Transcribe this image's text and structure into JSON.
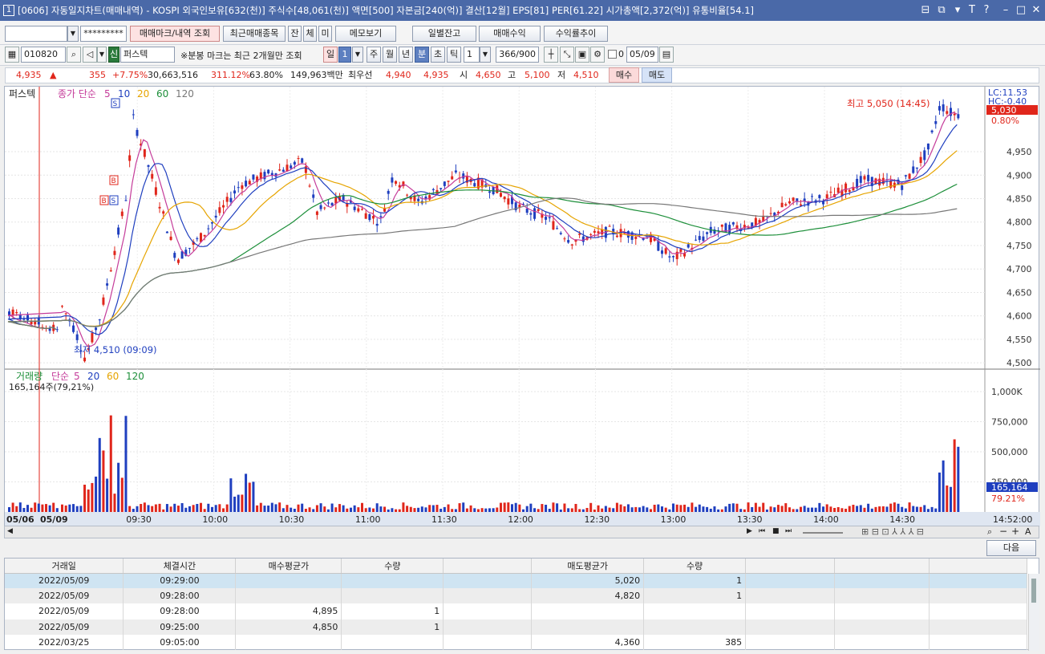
{
  "window": {
    "id": "1",
    "title": "[0606] 자동일지차트(매매내역) - KOSPI 외국인보유[632(천)] 주식수[48,061(천)] 액면[500] 자본금[240(억)] 결산[12월] EPS[81] PER[61.22] 시가총액[2,372(억)] 유통비율[54.1]"
  },
  "toolbar1": {
    "account_value": "",
    "password_mask": "*********",
    "btn_trade_mark": "매매마크/내역 조회",
    "btn_recent": "최근매매종목",
    "btn_jan": "잔",
    "btn_che": "체",
    "btn_mi": "미",
    "btn_memo": "메모보기",
    "btn_daily": "일별잔고",
    "btn_profit": "매매수익",
    "btn_trend": "수익률추이"
  },
  "toolbar2": {
    "stock_code": "010820",
    "market_badge": "신",
    "stock_name": "퍼스텍",
    "notice": "※분봉 마크는 최근 2개월만 조회",
    "period_day": "일",
    "period_num": "1",
    "period_week": "주",
    "period_month": "월",
    "period_year": "년",
    "period_min": "분",
    "period_sec": "초",
    "period_tick": "틱",
    "interval": "1",
    "count": "366/900",
    "zero_label": "0",
    "date": "05/09"
  },
  "quote": {
    "price": "4,935",
    "arrow": "▲",
    "change": "355",
    "rate": "+7.75%",
    "volume": "30,663,516",
    "vol_ratio": "311.12%",
    "turnover": "63.80%",
    "amount": "149,963백만",
    "priority_label": "최우선",
    "ask": "4,940",
    "bid": "4,935",
    "open_label": "시",
    "open": "4,650",
    "high_label": "고",
    "high": "5,100",
    "low_label": "저",
    "low": "4,510",
    "buy_btn": "매수",
    "sell_btn": "매도"
  },
  "chart_data": {
    "type": "candlestick",
    "stock": "퍼스텍",
    "indicator_title": "종가 단순",
    "ma_periods": [
      "5",
      "10",
      "20",
      "60",
      "120"
    ],
    "ma_colors": [
      "#c53c9a",
      "#1f3fbf",
      "#e6a400",
      "#1d8f3a",
      "#777777"
    ],
    "up_color": "#e0261b",
    "down_color": "#1f3fbf",
    "price_axis": [
      "4,950",
      "4,900",
      "4,850",
      "4,800",
      "4,750",
      "4,700",
      "4,650",
      "4,600",
      "4,550",
      "4,500"
    ],
    "price_range": [
      4490,
      5080
    ],
    "high_annotation": "최고 5,050 (14:45)",
    "low_annotation": "최저 4,510 (09:09)",
    "lc_label": "LC:11.53",
    "hc_label": "HC:-0.40",
    "current_price_tag": "5,030",
    "current_pct_tag": "0.80%",
    "volume_title": "거래량",
    "volume_ma_title": "단순",
    "volume_ma_periods": [
      "5",
      "20",
      "60",
      "120"
    ],
    "volume_info": "165,164주(79,21%)",
    "volume_axis": [
      "1,000K",
      "750,000",
      "500,000",
      "250,000"
    ],
    "volume_range": [
      0,
      1100000
    ],
    "current_volume_tag": "165,164",
    "current_volume_pct": "79.21%",
    "time_axis": [
      "05/06",
      "05/09",
      "09:30",
      "10:00",
      "10:30",
      "11:00",
      "11:30",
      "12:00",
      "12:30",
      "13:00",
      "13:30",
      "14:00",
      "14:30",
      "14:52:00"
    ],
    "close_series": [
      {
        "time": "09:00",
        "price": 4620
      },
      {
        "time": "09:05",
        "price": 4570
      },
      {
        "time": "09:09",
        "price": 4510
      },
      {
        "time": "09:15",
        "price": 4600
      },
      {
        "time": "09:25",
        "price": 4850
      },
      {
        "time": "09:28",
        "price": 5020
      },
      {
        "time": "09:35",
        "price": 4900
      },
      {
        "time": "09:45",
        "price": 4720
      },
      {
        "time": "09:55",
        "price": 4770
      },
      {
        "time": "10:10",
        "price": 4880
      },
      {
        "time": "10:20",
        "price": 4900
      },
      {
        "time": "10:35",
        "price": 4930
      },
      {
        "time": "10:40",
        "price": 4820
      },
      {
        "time": "10:50",
        "price": 4850
      },
      {
        "time": "11:05",
        "price": 4800
      },
      {
        "time": "11:10",
        "price": 4900
      },
      {
        "time": "11:20",
        "price": 4840
      },
      {
        "time": "11:35",
        "price": 4900
      },
      {
        "time": "11:50",
        "price": 4870
      },
      {
        "time": "12:00",
        "price": 4830
      },
      {
        "time": "12:10",
        "price": 4810
      },
      {
        "time": "12:20",
        "price": 4760
      },
      {
        "time": "12:35",
        "price": 4780
      },
      {
        "time": "12:50",
        "price": 4770
      },
      {
        "time": "13:00",
        "price": 4720
      },
      {
        "time": "13:05",
        "price": 4740
      },
      {
        "time": "13:15",
        "price": 4780
      },
      {
        "time": "13:25",
        "price": 4790
      },
      {
        "time": "13:35",
        "price": 4800
      },
      {
        "time": "13:45",
        "price": 4840
      },
      {
        "time": "14:00",
        "price": 4850
      },
      {
        "time": "14:15",
        "price": 4890
      },
      {
        "time": "14:30",
        "price": 4880
      },
      {
        "time": "14:40",
        "price": 4950
      },
      {
        "time": "14:45",
        "price": 5050
      },
      {
        "time": "14:50",
        "price": 5030
      }
    ],
    "trade_markers": [
      "S",
      "B",
      "B",
      "S"
    ]
  },
  "table": {
    "next_btn": "다음",
    "headers": [
      "거래일",
      "체결시간",
      "매수평균가",
      "수량",
      "",
      "매도평균가",
      "수량",
      "",
      "",
      ""
    ],
    "rows": [
      [
        "2022/05/09",
        "09:29:00",
        "",
        "",
        "",
        "5,020",
        "1",
        "",
        "",
        ""
      ],
      [
        "2022/05/09",
        "09:28:00",
        "",
        "",
        "",
        "4,820",
        "1",
        "",
        "",
        ""
      ],
      [
        "2022/05/09",
        "09:28:00",
        "4,895",
        "1",
        "",
        "",
        "",
        "",
        "",
        ""
      ],
      [
        "2022/05/09",
        "09:25:00",
        "4,850",
        "1",
        "",
        "",
        "",
        "",
        "",
        ""
      ],
      [
        "2022/03/25",
        "09:05:00",
        "",
        "",
        "",
        "4,360",
        "385",
        "",
        "",
        ""
      ]
    ]
  }
}
